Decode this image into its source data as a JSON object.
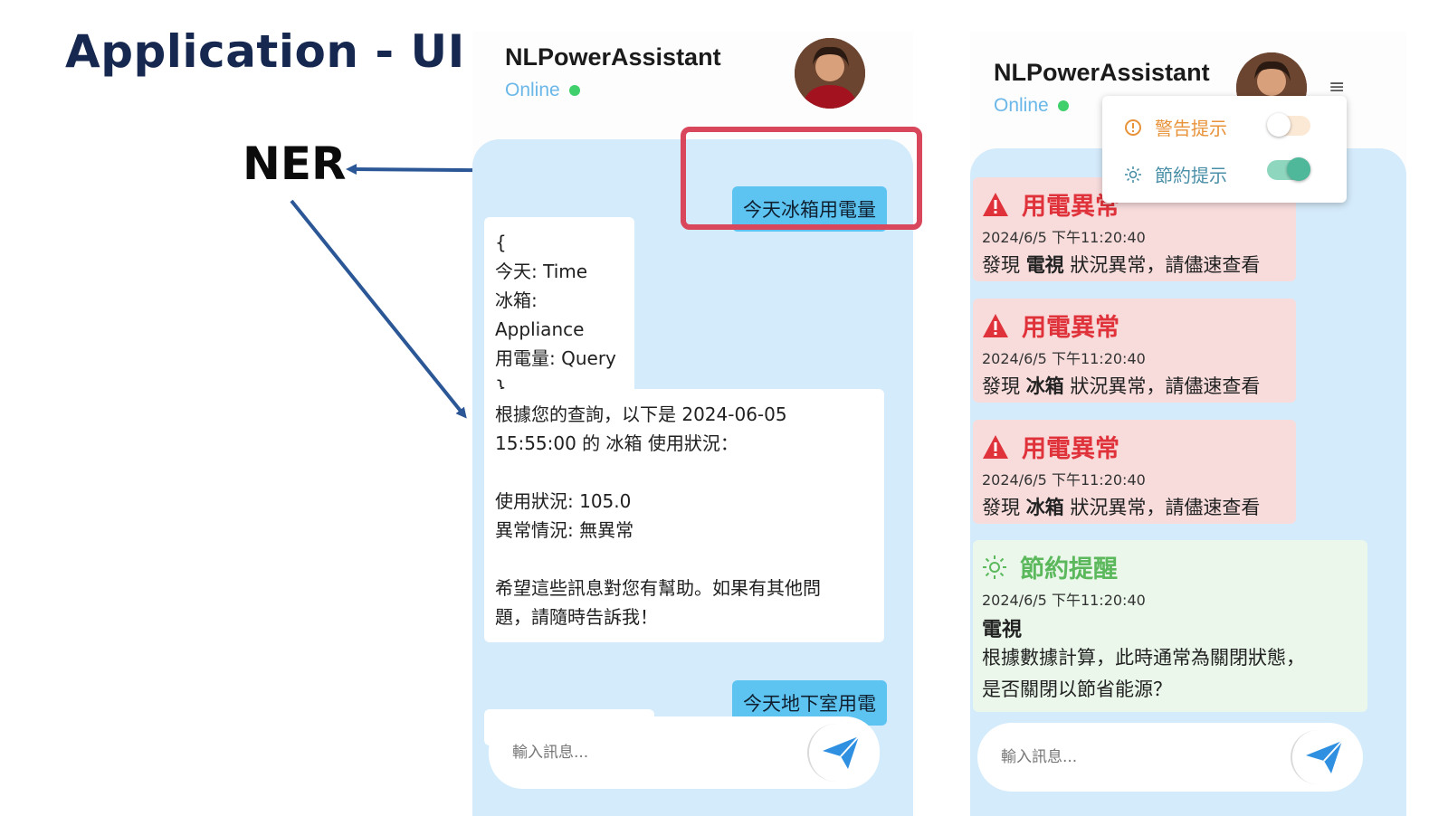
{
  "slide": {
    "title": "Application - UI",
    "ner_label": "NER"
  },
  "left_phone": {
    "app_name": "NLPowerAssistant",
    "status": "Online",
    "messages": [
      {
        "role": "user",
        "text": "今天冰箱用電量"
      },
      {
        "role": "bot",
        "text": "{\n今天: Time\n冰箱: Appliance\n用電量: Query\n}"
      },
      {
        "role": "bot",
        "text": "根據您的查詢，以下是 2024-06-05\n15:55:00 的 冰箱 使用狀況：\n\n使用狀況: 105.0\n異常情況: 無異常\n\n希望這些訊息對您有幫助。如果有其他問\n題，請隨時告訴我！"
      },
      {
        "role": "user",
        "text": "今天地下室用電"
      },
      {
        "role": "bot",
        "text": "{"
      }
    ],
    "input_placeholder": "輸入訊息..."
  },
  "right_phone": {
    "app_name": "NLPowerAssistant",
    "status": "Online",
    "input_placeholder": "輸入訊息...",
    "menu": [
      {
        "label": "警告提示",
        "enabled": false,
        "color": "#e8923a"
      },
      {
        "label": "節約提示",
        "enabled": true,
        "color": "#4a8fa8"
      }
    ],
    "alerts": [
      {
        "title": "用電異常",
        "time": "2024/6/5 下午11:20:40",
        "prefix": "發現 ",
        "device": "電視",
        "suffix": " 狀況異常，請儘速查看"
      },
      {
        "title": "用電異常",
        "time": "2024/6/5 下午11:20:40",
        "prefix": "發現 ",
        "device": "冰箱",
        "suffix": " 狀況異常，請儘速查看"
      },
      {
        "title": "用電異常",
        "time": "2024/6/5 下午11:20:40",
        "prefix": "發現 ",
        "device": "冰箱",
        "suffix": " 狀況異常，請儘速查看"
      }
    ],
    "saving": {
      "title": "節約提醒",
      "time": "2024/6/5 下午11:20:40",
      "device": "電視",
      "message_line1": "根據數據計算，此時通常為關閉狀態，",
      "message_line2": "是否關閉以節省能源？"
    }
  },
  "colors": {
    "title": "#16284f",
    "arrow": "#2b5796",
    "highlight": "#d9475c",
    "chat_bg": "#d4ebfb",
    "user_bubble": "#5dc4f2",
    "alert_bg": "#f8dcdc",
    "alert_red": "#e0323a",
    "saving_bg": "#eaf7ea",
    "saving_green": "#5cb85c",
    "toggle_on": "#4fb89a"
  }
}
